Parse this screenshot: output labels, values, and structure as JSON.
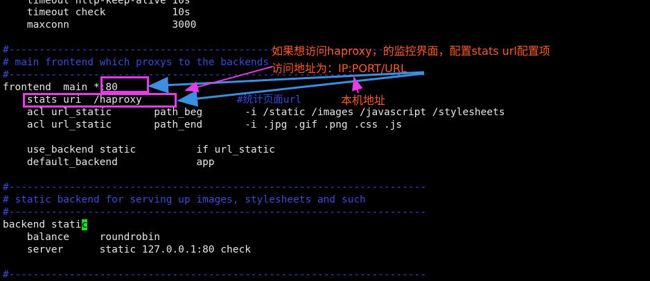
{
  "colors": {
    "background": "#000000",
    "text": "#e6e6e6",
    "comment": "#3a4bd8",
    "highlight_box": "#e83ce8",
    "annotation_text": "#ff5a2a",
    "arrow_blue": "#3c8fe0",
    "arrow_magenta": "#e83ce8",
    "cursor": "#19e019"
  },
  "terminal": {
    "lines": [
      "    timeout http-keep-alive 10s",
      "    timeout check           10s",
      "    maxconn                 3000",
      "",
      "#---------------------------------------------------------------------",
      "# main frontend which proxys to the backends",
      "#---------------------------------------------------------------------",
      "frontend  main *:80",
      "    stats uri  /haproxy",
      "    acl url_static       path_beg       -i /static /images /javascript /stylesheets",
      "    acl url_static       path_end       -i .jpg .gif .png .css .js",
      "",
      "    use_backend static          if url_static",
      "    default_backend             app",
      "",
      "#---------------------------------------------------------------------",
      "# static backend for serving up images, stylesheets and such",
      "#---------------------------------------------------------------------",
      "backend stati",
      "    balance     roundrobin",
      "    server      static 127.0.0.1:80 check",
      "",
      "#---------------------------------------------------------------------"
    ],
    "inline_comment": "#统计页面url",
    "cursor_char": "c"
  },
  "annotations": {
    "note1": "如果想访问haproxy，的监控界面，配置stats url配置项",
    "note2": "访问地址为：IP:PORT/URL",
    "note3": "本机地址"
  }
}
